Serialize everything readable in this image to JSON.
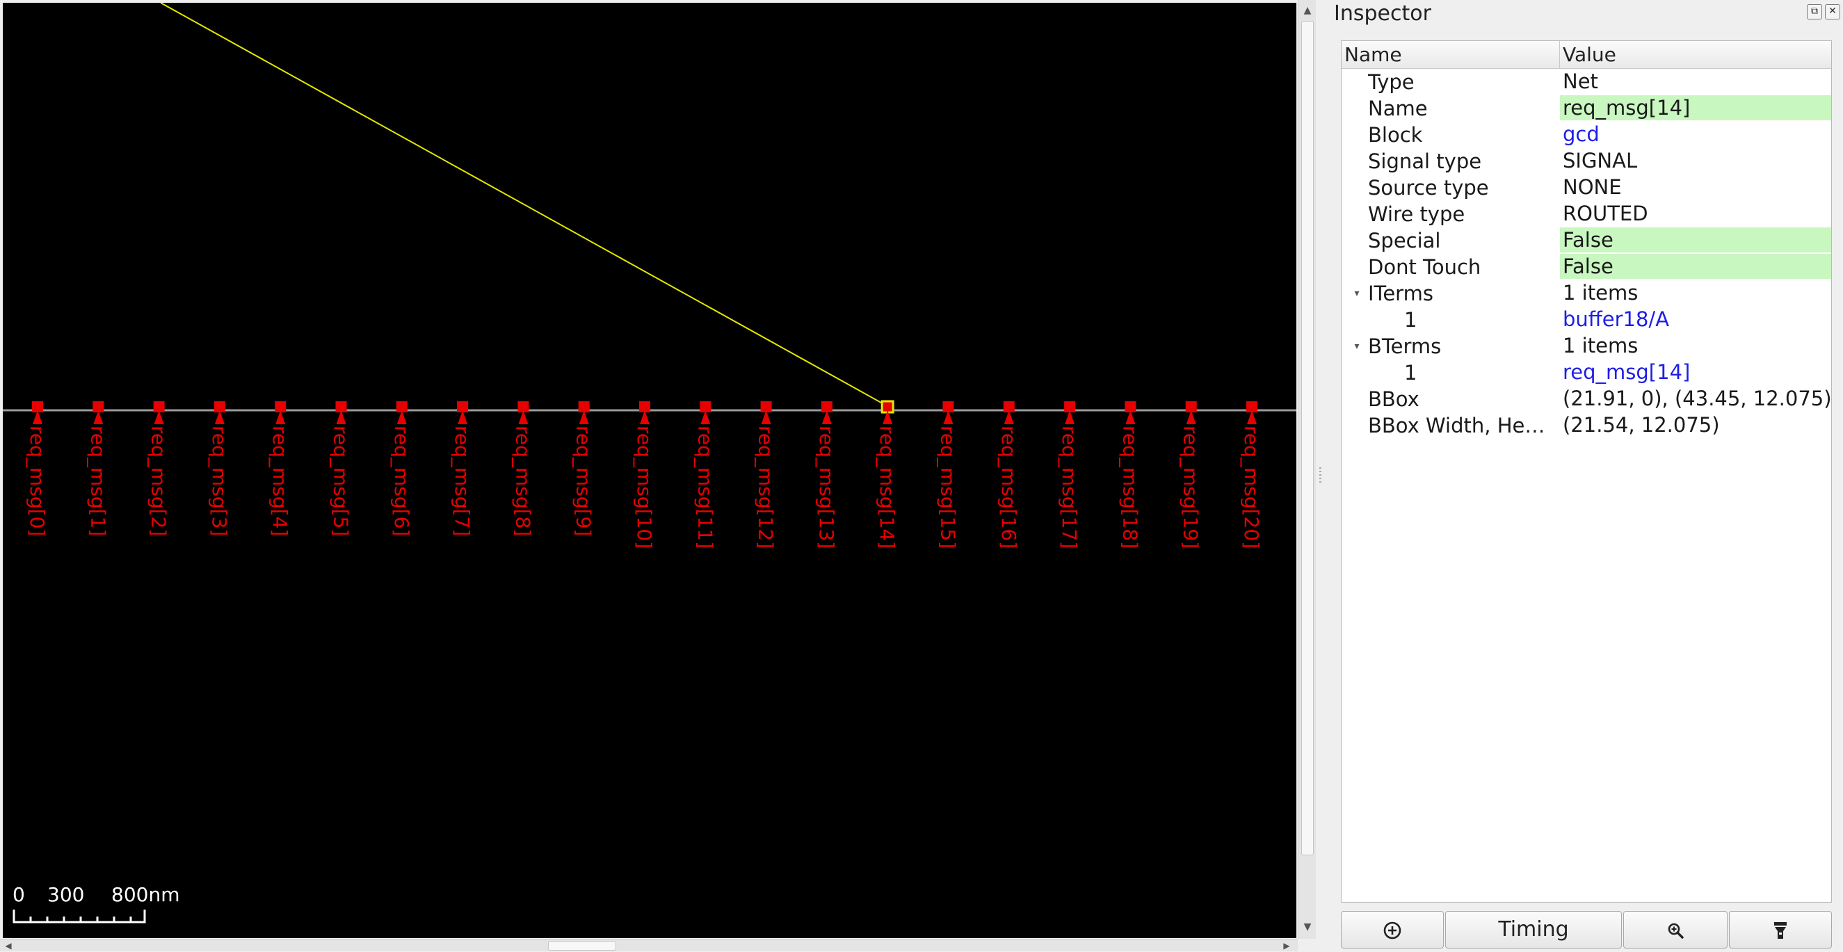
{
  "viewer": {
    "pin_labels": [
      "req_msg[0]",
      "req_msg[1]",
      "req_msg[2]",
      "req_msg[3]",
      "req_msg[4]",
      "req_msg[5]",
      "req_msg[6]",
      "req_msg[7]",
      "req_msg[8]",
      "req_msg[9]",
      "req_msg[10]",
      "req_msg[11]",
      "req_msg[12]",
      "req_msg[13]",
      "req_msg[14]",
      "req_msg[15]",
      "req_msg[16]",
      "req_msg[17]",
      "req_msg[18]",
      "req_msg[19]",
      "req_msg[20]"
    ],
    "selected_pin": "req_msg[14]",
    "scale_bar": {
      "tick0": "0",
      "tick1": "300",
      "tick2": "800nm"
    },
    "colors": {
      "pin": "#e60000",
      "selection": "#e6e600",
      "background": "#000000",
      "boundary": "#9a9a9a"
    }
  },
  "inspector": {
    "title": "Inspector",
    "float_icon": "float-icon",
    "close_icon": "close-icon",
    "columns": {
      "name": "Name",
      "value": "Value"
    },
    "rows": [
      {
        "name": "Type",
        "value": "Net",
        "style": "plain"
      },
      {
        "name": "Name",
        "value": "req_msg[14]",
        "style": "edit"
      },
      {
        "name": "Block",
        "value": "gcd",
        "style": "link"
      },
      {
        "name": "Signal type",
        "value": "SIGNAL",
        "style": "plain"
      },
      {
        "name": "Source type",
        "value": "NONE",
        "style": "plain"
      },
      {
        "name": "Wire type",
        "value": "ROUTED",
        "style": "plain"
      },
      {
        "name": "Special",
        "value": "False",
        "style": "edit"
      },
      {
        "name": "Dont Touch",
        "value": "False",
        "style": "edit"
      },
      {
        "name": "ITerms",
        "value": "1 items",
        "style": "plain",
        "expander": true
      },
      {
        "name": "1",
        "value": "buffer18/A",
        "style": "link",
        "child": true
      },
      {
        "name": "BTerms",
        "value": "1 items",
        "style": "plain",
        "expander": true
      },
      {
        "name": "1",
        "value": "req_msg[14]",
        "style": "link",
        "child": true
      },
      {
        "name": "BBox",
        "value": "(21.91, 0), (43.45, 12.075)",
        "style": "plain"
      },
      {
        "name": "BBox Width, He…",
        "value": "(21.54, 12.075)",
        "style": "plain"
      }
    ],
    "buttons": {
      "add_icon": "add-circle-icon",
      "timing": "Timing",
      "zoom_icon": "zoom-icon",
      "highlight_icon": "flashlight-icon"
    }
  }
}
